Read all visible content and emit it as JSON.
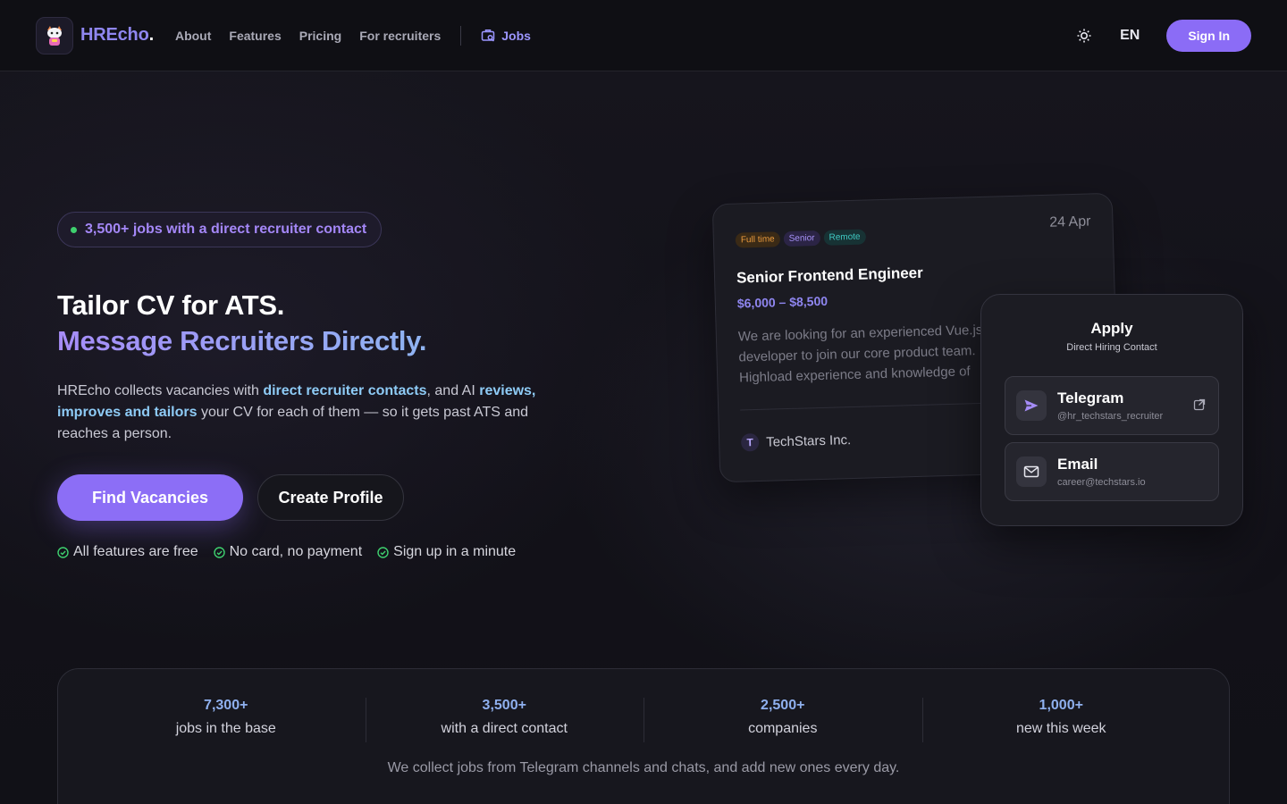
{
  "header": {
    "logo_text": "HREcho",
    "logo_dot": ".",
    "nav": [
      {
        "label": "About"
      },
      {
        "label": "Features"
      },
      {
        "label": "Pricing"
      },
      {
        "label": "For recruiters"
      }
    ],
    "jobs_label": "Jobs",
    "lang": "EN",
    "signin_label": "Sign In"
  },
  "hero": {
    "badge": "3,500+ jobs with a direct recruiter contact",
    "title_line1": "Tailor CV for ATS.",
    "title_line2": "Message Recruiters Directly.",
    "desc_part1": "HREcho collects vacancies with ",
    "desc_hl1": "direct recruiter contacts",
    "desc_part2": ", and AI ",
    "desc_hl2": "reviews, improves and tailors",
    "desc_part3": " your CV for each of them — so it gets past ATS and reaches a person.",
    "primary_btn": "Find Vacancies",
    "secondary_btn": "Create Profile",
    "checks": [
      "All features are free",
      "No card, no payment",
      "Sign up in a minute"
    ]
  },
  "job_card": {
    "tags": [
      "Full time",
      "Senior",
      "Remote"
    ],
    "date": "24 Apr",
    "title": "Senior Frontend Engineer",
    "salary": "$6,000 – $8,500",
    "description": "We are looking for an experienced Vue.js developer to join our core product team. Highload experience and knowledge of Vite/Pinia required...",
    "company_initial": "T",
    "company": "TechStars Inc."
  },
  "apply_card": {
    "title": "Apply",
    "subtitle": "Direct Hiring Contact",
    "contacts": [
      {
        "name": "Telegram",
        "handle": "@hr_techstars_recruiter"
      },
      {
        "name": "Email",
        "handle": "career@techstars.io"
      }
    ]
  },
  "stats": {
    "items": [
      {
        "value": "7,300+",
        "label": "jobs in the base"
      },
      {
        "value": "3,500+",
        "label": "with a direct contact"
      },
      {
        "value": "2,500+",
        "label": "companies"
      },
      {
        "value": "1,000+",
        "label": "new this week"
      }
    ],
    "note": "We collect jobs from Telegram channels and chats, and add new ones every day."
  },
  "colors": {
    "accent": "#8c6ef6",
    "link_highlight": "#8ecbf6",
    "check_green": "#3ecf6e"
  }
}
